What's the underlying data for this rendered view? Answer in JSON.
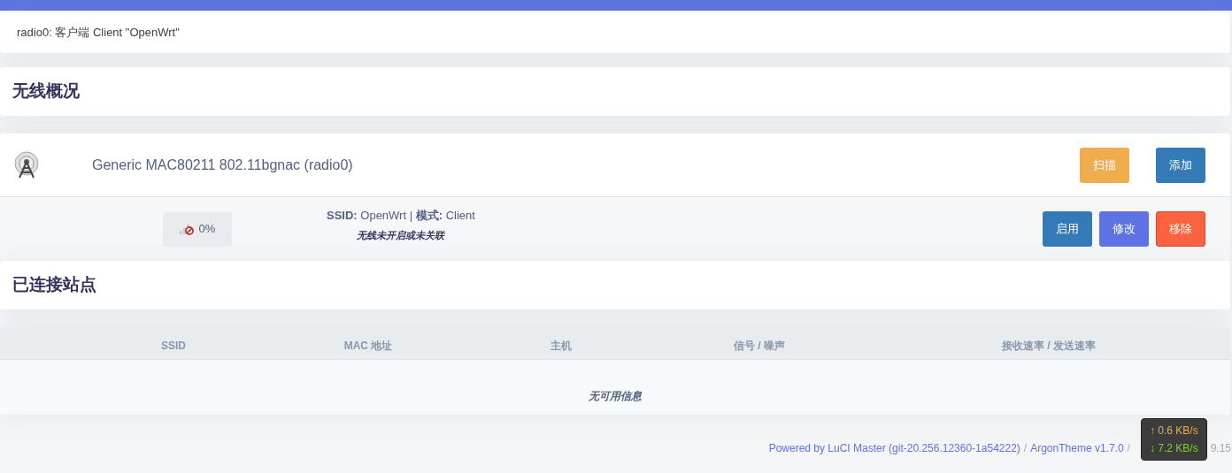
{
  "notice": "radio0: 客户端 Client \"OpenWrt\"",
  "overview": {
    "title": "无线概况",
    "device": {
      "name": "Generic MAC80211 802.11bgnac (radio0)",
      "buttons": [
        {
          "label": "扫描",
          "kind": "warning"
        },
        {
          "label": "添加",
          "kind": "primary"
        }
      ]
    },
    "networks": [
      {
        "signal": "0%",
        "ssid_label": "SSID:",
        "ssid": "OpenWrt",
        "separator": "|",
        "mode_label": "模式:",
        "mode": "Client",
        "status": "无线未开启或未关联",
        "buttons": [
          {
            "label": "启用",
            "kind": "primary"
          },
          {
            "label": "修改",
            "kind": "edit"
          },
          {
            "label": "移除",
            "kind": "danger"
          }
        ]
      }
    ]
  },
  "stations": {
    "title": "已连接站点",
    "columns": [
      "SSID",
      "MAC 地址",
      "主机",
      "信号 / 噪声",
      "接收速率 / 发送速率"
    ],
    "empty": "无可用信息"
  },
  "footer": {
    "links": [
      "Powered by LuCI Master (git-20.256.12360-1a54222)",
      "ArgonTheme v1.7.0"
    ],
    "separator": "/",
    "tail": "9.15"
  },
  "speed": {
    "up": "↑ 0.6 KB/s",
    "down": "↓ 7.2 KB/s"
  }
}
